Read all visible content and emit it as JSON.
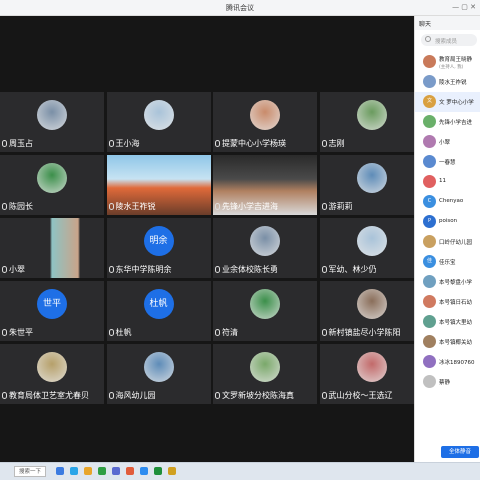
{
  "app": {
    "title": "腾讯会议"
  },
  "sidebar": {
    "header": "聊天",
    "search_placeholder": "搜索成员",
    "mute_all": "全体静音",
    "participants": [
      {
        "name": "教育局王晓静",
        "sub": "(主持人, 我)",
        "avatar": ""
      },
      {
        "name": "陵水王祚锐",
        "sub": "",
        "avatar": ""
      },
      {
        "name": "文 罗中心小学",
        "sub": "",
        "avatar": "文"
      },
      {
        "name": "先锋小学吉进",
        "sub": "",
        "avatar": ""
      },
      {
        "name": "小翠",
        "sub": "",
        "avatar": ""
      },
      {
        "name": "一春慧",
        "sub": "",
        "avatar": ""
      },
      {
        "name": "11",
        "sub": "",
        "avatar": ""
      },
      {
        "name": "Chenyao",
        "sub": "",
        "avatar": "C"
      },
      {
        "name": "poison",
        "sub": "",
        "avatar": "P"
      },
      {
        "name": "口岭仔幼儿园",
        "sub": "",
        "avatar": ""
      },
      {
        "name": "佳乐宝",
        "sub": "",
        "avatar": "佳"
      },
      {
        "name": "本号黎盘小学",
        "sub": "",
        "avatar": ""
      },
      {
        "name": "本号镇日石幼",
        "sub": "",
        "avatar": ""
      },
      {
        "name": "本号镇大里幼",
        "sub": "",
        "avatar": ""
      },
      {
        "name": "本号镇椰关幼",
        "sub": "",
        "avatar": ""
      },
      {
        "name": "冰冰1890760",
        "sub": "",
        "avatar": ""
      },
      {
        "name": "蔡静",
        "sub": "",
        "avatar": ""
      }
    ]
  },
  "tiles": [
    {
      "label": "周玉占",
      "avatar": "photo"
    },
    {
      "label": "王小海",
      "avatar": "photo"
    },
    {
      "label": "提蒙中心小学杨瑛",
      "avatar": "photo"
    },
    {
      "label": "志刚",
      "avatar": "photo"
    },
    {
      "label": "陈园长",
      "avatar": "photo"
    },
    {
      "label": "陵水王祚锐",
      "avatar": "camera"
    },
    {
      "label": "先锋小学吉进海",
      "avatar": "camera"
    },
    {
      "label": "游莉莉",
      "avatar": "photo"
    },
    {
      "label": "小翠",
      "avatar": "camera"
    },
    {
      "label": "东华中学陈明余",
      "avatar": "明余"
    },
    {
      "label": "业余体校陈长勇",
      "avatar": "photo"
    },
    {
      "label": "军幼、林少仍",
      "avatar": "photo"
    },
    {
      "label": "朱世平",
      "avatar": "世平"
    },
    {
      "label": "杜帆",
      "avatar": "杜帆"
    },
    {
      "label": "符清",
      "avatar": "photo"
    },
    {
      "label": "新村镇盐尽小学陈阳",
      "avatar": "photo"
    },
    {
      "label": "教育局体卫艺室尤春贝",
      "avatar": "photo"
    },
    {
      "label": "海风幼儿园",
      "avatar": "photo"
    },
    {
      "label": "文罗新坡分校陈海真",
      "avatar": "photo"
    },
    {
      "label": "武山分校～王选辽",
      "avatar": "photo"
    }
  ],
  "taskbar": {
    "search": "搜索一下"
  }
}
